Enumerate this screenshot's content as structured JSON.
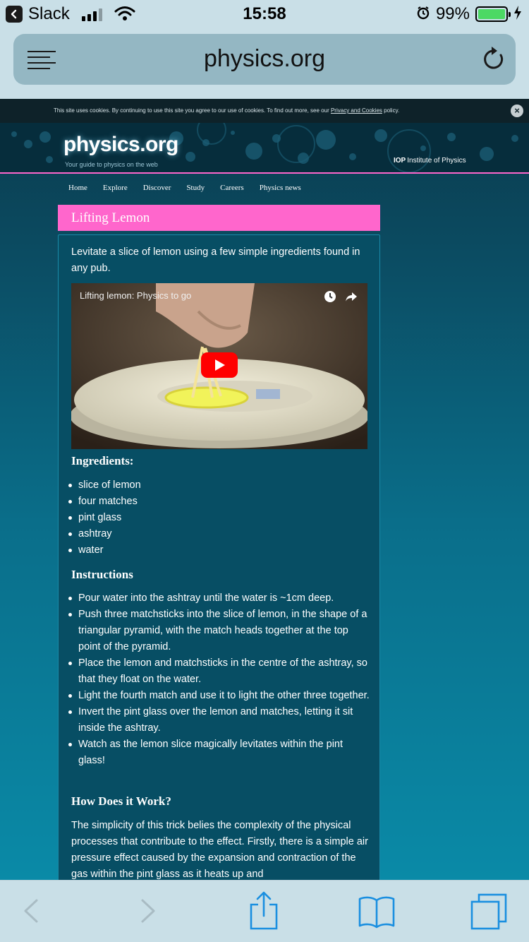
{
  "status_bar": {
    "back_app": "Slack",
    "time": "15:58",
    "battery_percent": "99%",
    "battery_level": 0.99,
    "signal_bars_filled": 3,
    "signal_bars_total": 4
  },
  "browser": {
    "url": "physics.org"
  },
  "site": {
    "cookie_notice": "This site uses cookies. By continuing to use this site you agree to our use of cookies. To find out more, see our",
    "cookie_link": "Privacy and Cookies",
    "cookie_suffix": "policy.",
    "cookie_close": "×",
    "logo": "physics.org",
    "tagline": "Your guide to physics on the web",
    "iop_abbr": "IOP",
    "iop_name": "Institute of Physics",
    "nav": [
      "Home",
      "Explore",
      "Discover",
      "Study",
      "Careers",
      "Physics news"
    ],
    "accent_color": "#ff66cc"
  },
  "article": {
    "title": "Lifting Lemon",
    "intro": "Levitate a slice of lemon using a few simple ingredients found in any pub.",
    "video_title": "Lifting lemon: Physics to go",
    "ingredients_heading": "Ingredients:",
    "ingredients": [
      "slice of lemon",
      "four matches",
      "pint glass",
      "ashtray",
      "water"
    ],
    "instructions_heading": "Instructions",
    "instructions": [
      "Pour water into the ashtray until the water is ~1cm deep.",
      "Push three matchsticks into the slice of lemon, in the shape of a triangular pyramid, with the match heads together at the top point of the pyramid.",
      "Place the lemon and matchsticks in the centre of the ashtray, so that they float on the water.",
      "Light the fourth match and use it to light the other three together.",
      "Invert the pint glass over the lemon and matches, letting it sit inside the ashtray.",
      "Watch as the lemon slice magically levitates within the pint glass!"
    ],
    "how_heading": "How Does it Work?",
    "how_body": "The simplicity of this trick belies the complexity of the physical processes that contribute to the effect. Firstly, there is a simple air pressure effect caused by the expansion and contraction of the gas within the pint glass as it heats up and"
  },
  "toolbar": {
    "icons": [
      "back-icon",
      "forward-icon",
      "share-icon",
      "bookmarks-icon",
      "tabs-icon"
    ]
  }
}
